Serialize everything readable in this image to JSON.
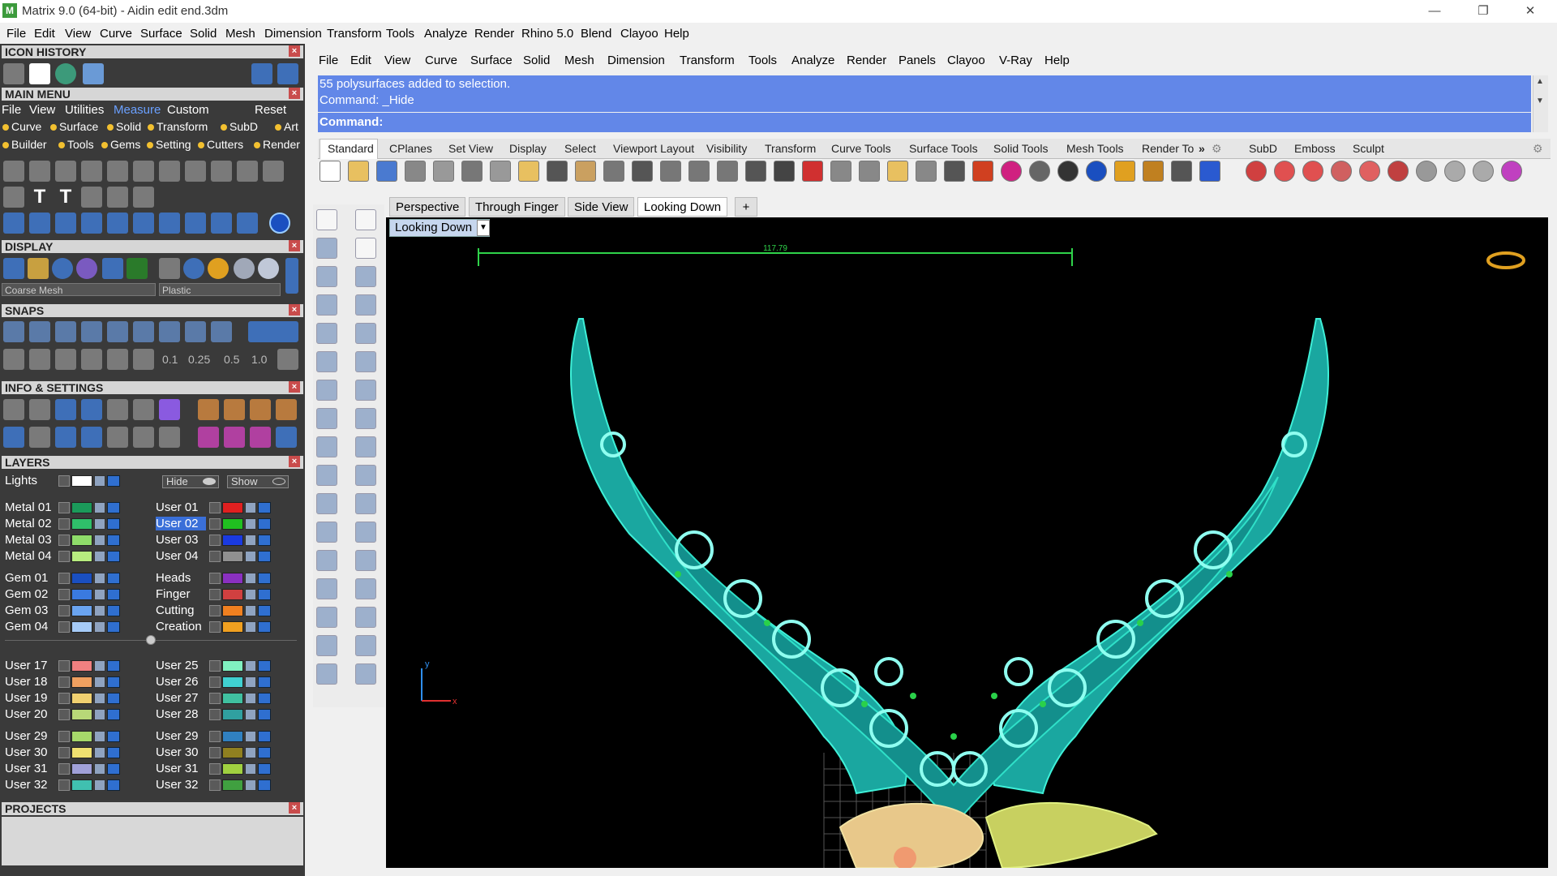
{
  "window": {
    "title": "Matrix 9.0 (64-bit) - Aidin edit end.3dm",
    "app_icon": "matrix-app-icon"
  },
  "outer_menu": [
    "File",
    "Edit",
    "View",
    "Curve",
    "Surface",
    "Solid",
    "Mesh",
    "Dimension",
    "Transform",
    "Tools",
    "Analyze",
    "Render",
    "Rhino 5.0",
    "Blend",
    "Clayoo",
    "Help"
  ],
  "panels": {
    "icon_history": "ICON HISTORY",
    "main_menu": "MAIN MENU",
    "display": "DISPLAY",
    "snaps": "SNAPS",
    "info_settings": "INFO & SETTINGS",
    "layers": "LAYERS",
    "projects": "PROJECTS",
    "close_glyph": "×"
  },
  "main_menu": {
    "items": [
      "File",
      "View",
      "Utilities",
      "Measure",
      "Custom"
    ],
    "reset": "Reset",
    "categories_row1": [
      "Curve",
      "Surface",
      "Solid",
      "Transform",
      "SubD",
      "Art"
    ],
    "categories_row2": [
      "Builder",
      "Tools",
      "Gems",
      "Setting",
      "Cutters",
      "Render"
    ]
  },
  "display": {
    "mesh_select": "Coarse Mesh",
    "material_select": "Plastic"
  },
  "snaps": {
    "values": [
      "0.1",
      "0.25",
      "0.5",
      "1.0"
    ]
  },
  "layers": {
    "lights": "Lights",
    "hide": "Hide",
    "show": "Show",
    "left_column": [
      {
        "name": "Metal 01",
        "color": "#1b9a5a"
      },
      {
        "name": "Metal 02",
        "color": "#2fbf6a"
      },
      {
        "name": "Metal 03",
        "color": "#8fdc6a"
      },
      {
        "name": "Metal 04",
        "color": "#b7ec7f"
      },
      {
        "name": "Gem 01",
        "color": "#1a4fc0"
      },
      {
        "name": "Gem 02",
        "color": "#3a7ae0"
      },
      {
        "name": "Gem 03",
        "color": "#6aa4f0"
      },
      {
        "name": "Gem 04",
        "color": "#a6cbf7"
      },
      {
        "name": "User 17",
        "color": "#f08080"
      },
      {
        "name": "User 18",
        "color": "#f0a060"
      },
      {
        "name": "User 19",
        "color": "#f0d070"
      },
      {
        "name": "User 20",
        "color": "#b8d878"
      },
      {
        "name": "User 29",
        "color": "#a6d86a"
      },
      {
        "name": "User 30",
        "color": "#f0e070"
      },
      {
        "name": "User 31",
        "color": "#a0a0d8"
      },
      {
        "name": "User 32",
        "color": "#40c0b0"
      }
    ],
    "right_column": [
      {
        "name": "User 01",
        "color": "#e02020"
      },
      {
        "name": "User 02",
        "color": "#20c020",
        "selected": true
      },
      {
        "name": "User 03",
        "color": "#1a3ae0"
      },
      {
        "name": "User 04",
        "color": "#909090"
      },
      {
        "name": "Heads",
        "color": "#8a30c0"
      },
      {
        "name": "Finger",
        "color": "#d04040"
      },
      {
        "name": "Cutting",
        "color": "#f08020"
      },
      {
        "name": "Creation",
        "color": "#f0a020"
      },
      {
        "name": "User 25",
        "color": "#80f0c0"
      },
      {
        "name": "User 26",
        "color": "#40d0d0"
      },
      {
        "name": "User 27",
        "color": "#40c0a0"
      },
      {
        "name": "User 28",
        "color": "#30a0a0"
      },
      {
        "name": "User 29",
        "color": "#3080c0"
      },
      {
        "name": "User 30",
        "color": "#908020"
      },
      {
        "name": "User 31",
        "color": "#a0d040"
      },
      {
        "name": "User 32",
        "color": "#40a040"
      }
    ]
  },
  "rhino_menu": [
    "File",
    "Edit",
    "View",
    "Curve",
    "Surface",
    "Solid",
    "Mesh",
    "Dimension",
    "Transform",
    "Tools",
    "Analyze",
    "Render",
    "Panels",
    "Clayoo",
    "V-Ray",
    "Help"
  ],
  "command": {
    "history_line1": "55 polysurfaces added to selection.",
    "history_line2": "Command: _Hide",
    "prompt": "Command:"
  },
  "toolbar_tabs": [
    "Standard",
    "CPlanes",
    "Set View",
    "Display",
    "Select",
    "Viewport Layout",
    "Visibility",
    "Transform",
    "Curve Tools",
    "Surface Tools",
    "Solid Tools",
    "Mesh Tools",
    "Render To"
  ],
  "toolbar_tabs_more": "»",
  "toolbar_tabs_right": [
    "SubD",
    "Emboss",
    "Sculpt"
  ],
  "viewport_tabs": [
    "Perspective",
    "Through Finger",
    "Side View",
    "Looking Down"
  ],
  "viewport_add": "+",
  "viewport": {
    "name": "Looking Down",
    "dimension_label": "117.79",
    "axis_y": "y",
    "axis_x": "x"
  }
}
